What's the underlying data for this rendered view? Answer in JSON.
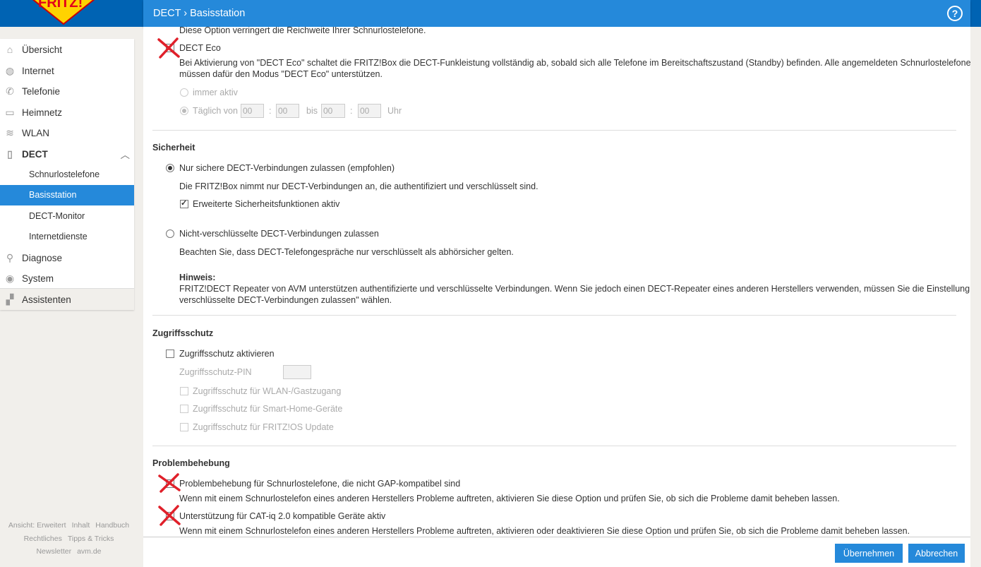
{
  "header": {
    "breadcrumb_parent": "DECT",
    "breadcrumb_sep": "›",
    "breadcrumb_current": "Basisstation",
    "help": "?"
  },
  "logo": {
    "text": "FRITZ!"
  },
  "sidebar": {
    "items": [
      {
        "label": "Übersicht",
        "icon": "home-icon"
      },
      {
        "label": "Internet",
        "icon": "globe-icon"
      },
      {
        "label": "Telefonie",
        "icon": "phone-icon"
      },
      {
        "label": "Heimnetz",
        "icon": "network-icon"
      },
      {
        "label": "WLAN",
        "icon": "wifi-icon"
      },
      {
        "label": "DECT",
        "icon": "dect-phone-icon"
      },
      {
        "label": "Diagnose",
        "icon": "diagnose-icon"
      },
      {
        "label": "System",
        "icon": "system-icon"
      },
      {
        "label": "Assistenten",
        "icon": "assistant-icon"
      }
    ],
    "dect_sub": [
      "Schnurlostelefone",
      "Basisstation",
      "DECT-Monitor",
      "Internetdienste"
    ]
  },
  "footer_links": [
    "Ansicht: Erweitert",
    "Inhalt",
    "Handbuch",
    "Rechtliches",
    "Tipps & Tricks",
    "Newsletter",
    "avm.de"
  ],
  "eco": {
    "top_text": "Diese Option verringert die Reichweite Ihrer Schnurlostelefone.",
    "label": "DECT Eco",
    "desc1": "Bei Aktivierung von \"DECT Eco\" schaltet die FRITZ!Box die DECT-Funkleistung vollständig ab, sobald sich alle Telefone im Bereitschaftszustand (Standby) befinden. Alle angemeldeten Schnurlostelefone",
    "desc2": "müssen dafür den Modus \"DECT Eco\" unterstützen.",
    "always": "immer aktiv",
    "daily": "Täglich von",
    "h1": "00",
    "colon": ":",
    "m1": "00",
    "bis": "bis",
    "h2": "00",
    "m2": "00",
    "uhr": "Uhr"
  },
  "security": {
    "title": "Sicherheit",
    "opt1": "Nur sichere DECT-Verbindungen zulassen (empfohlen)",
    "opt1_desc": "Die FRITZ!Box nimmt nur DECT-Verbindungen an, die authentifiziert und verschlüsselt sind.",
    "ext": "Erweiterte Sicherheitsfunktionen aktiv",
    "opt2": "Nicht-verschlüsselte DECT-Verbindungen zulassen",
    "opt2_desc": "Beachten Sie, dass DECT-Telefongespräche nur verschlüsselt als abhörsicher gelten.",
    "hint_title": "Hinweis:",
    "hint1": "FRITZ!DECT Repeater von AVM unterstützen authentifizierte und verschlüsselte Verbindungen. Wenn Sie jedoch einen DECT-Repeater eines anderen Herstellers verwenden, müssen Sie die Einstellung \"Nicht-",
    "hint2": "verschlüsselte DECT-Verbindungen zulassen\" wählen."
  },
  "access": {
    "title": "Zugriffsschutz",
    "enable": "Zugriffsschutz aktivieren",
    "pin_label": "Zugriffsschutz-PIN",
    "pin": "",
    "wlan": "Zugriffsschutz für WLAN-/Gastzugang",
    "smarthome": "Zugriffsschutz für Smart-Home-Geräte",
    "update": "Zugriffsschutz für FRITZ!OS Update"
  },
  "trouble": {
    "title": "Problembehebung",
    "gap": "Problembehebung für Schnurlostelefone, die nicht GAP-kompatibel sind",
    "gap_desc": "Wenn mit einem Schnurlostelefon eines anderen Herstellers Probleme auftreten, aktivieren Sie diese Option und prüfen Sie, ob sich die Probleme damit beheben lassen.",
    "catiq": "Unterstützung für CAT-iq 2.0 kompatible Geräte aktiv",
    "catiq_desc": "Wenn mit einem Schnurlostelefon eines anderen Herstellers Probleme auftreten, aktivieren oder deaktivieren Sie diese Option und prüfen Sie, ob sich die Probleme damit beheben lassen."
  },
  "buttons": {
    "apply": "Übernehmen",
    "cancel": "Abbrechen"
  },
  "colors": {
    "topbar": "#0063b3",
    "accent": "#2589da",
    "annotation": "#e0202a"
  }
}
